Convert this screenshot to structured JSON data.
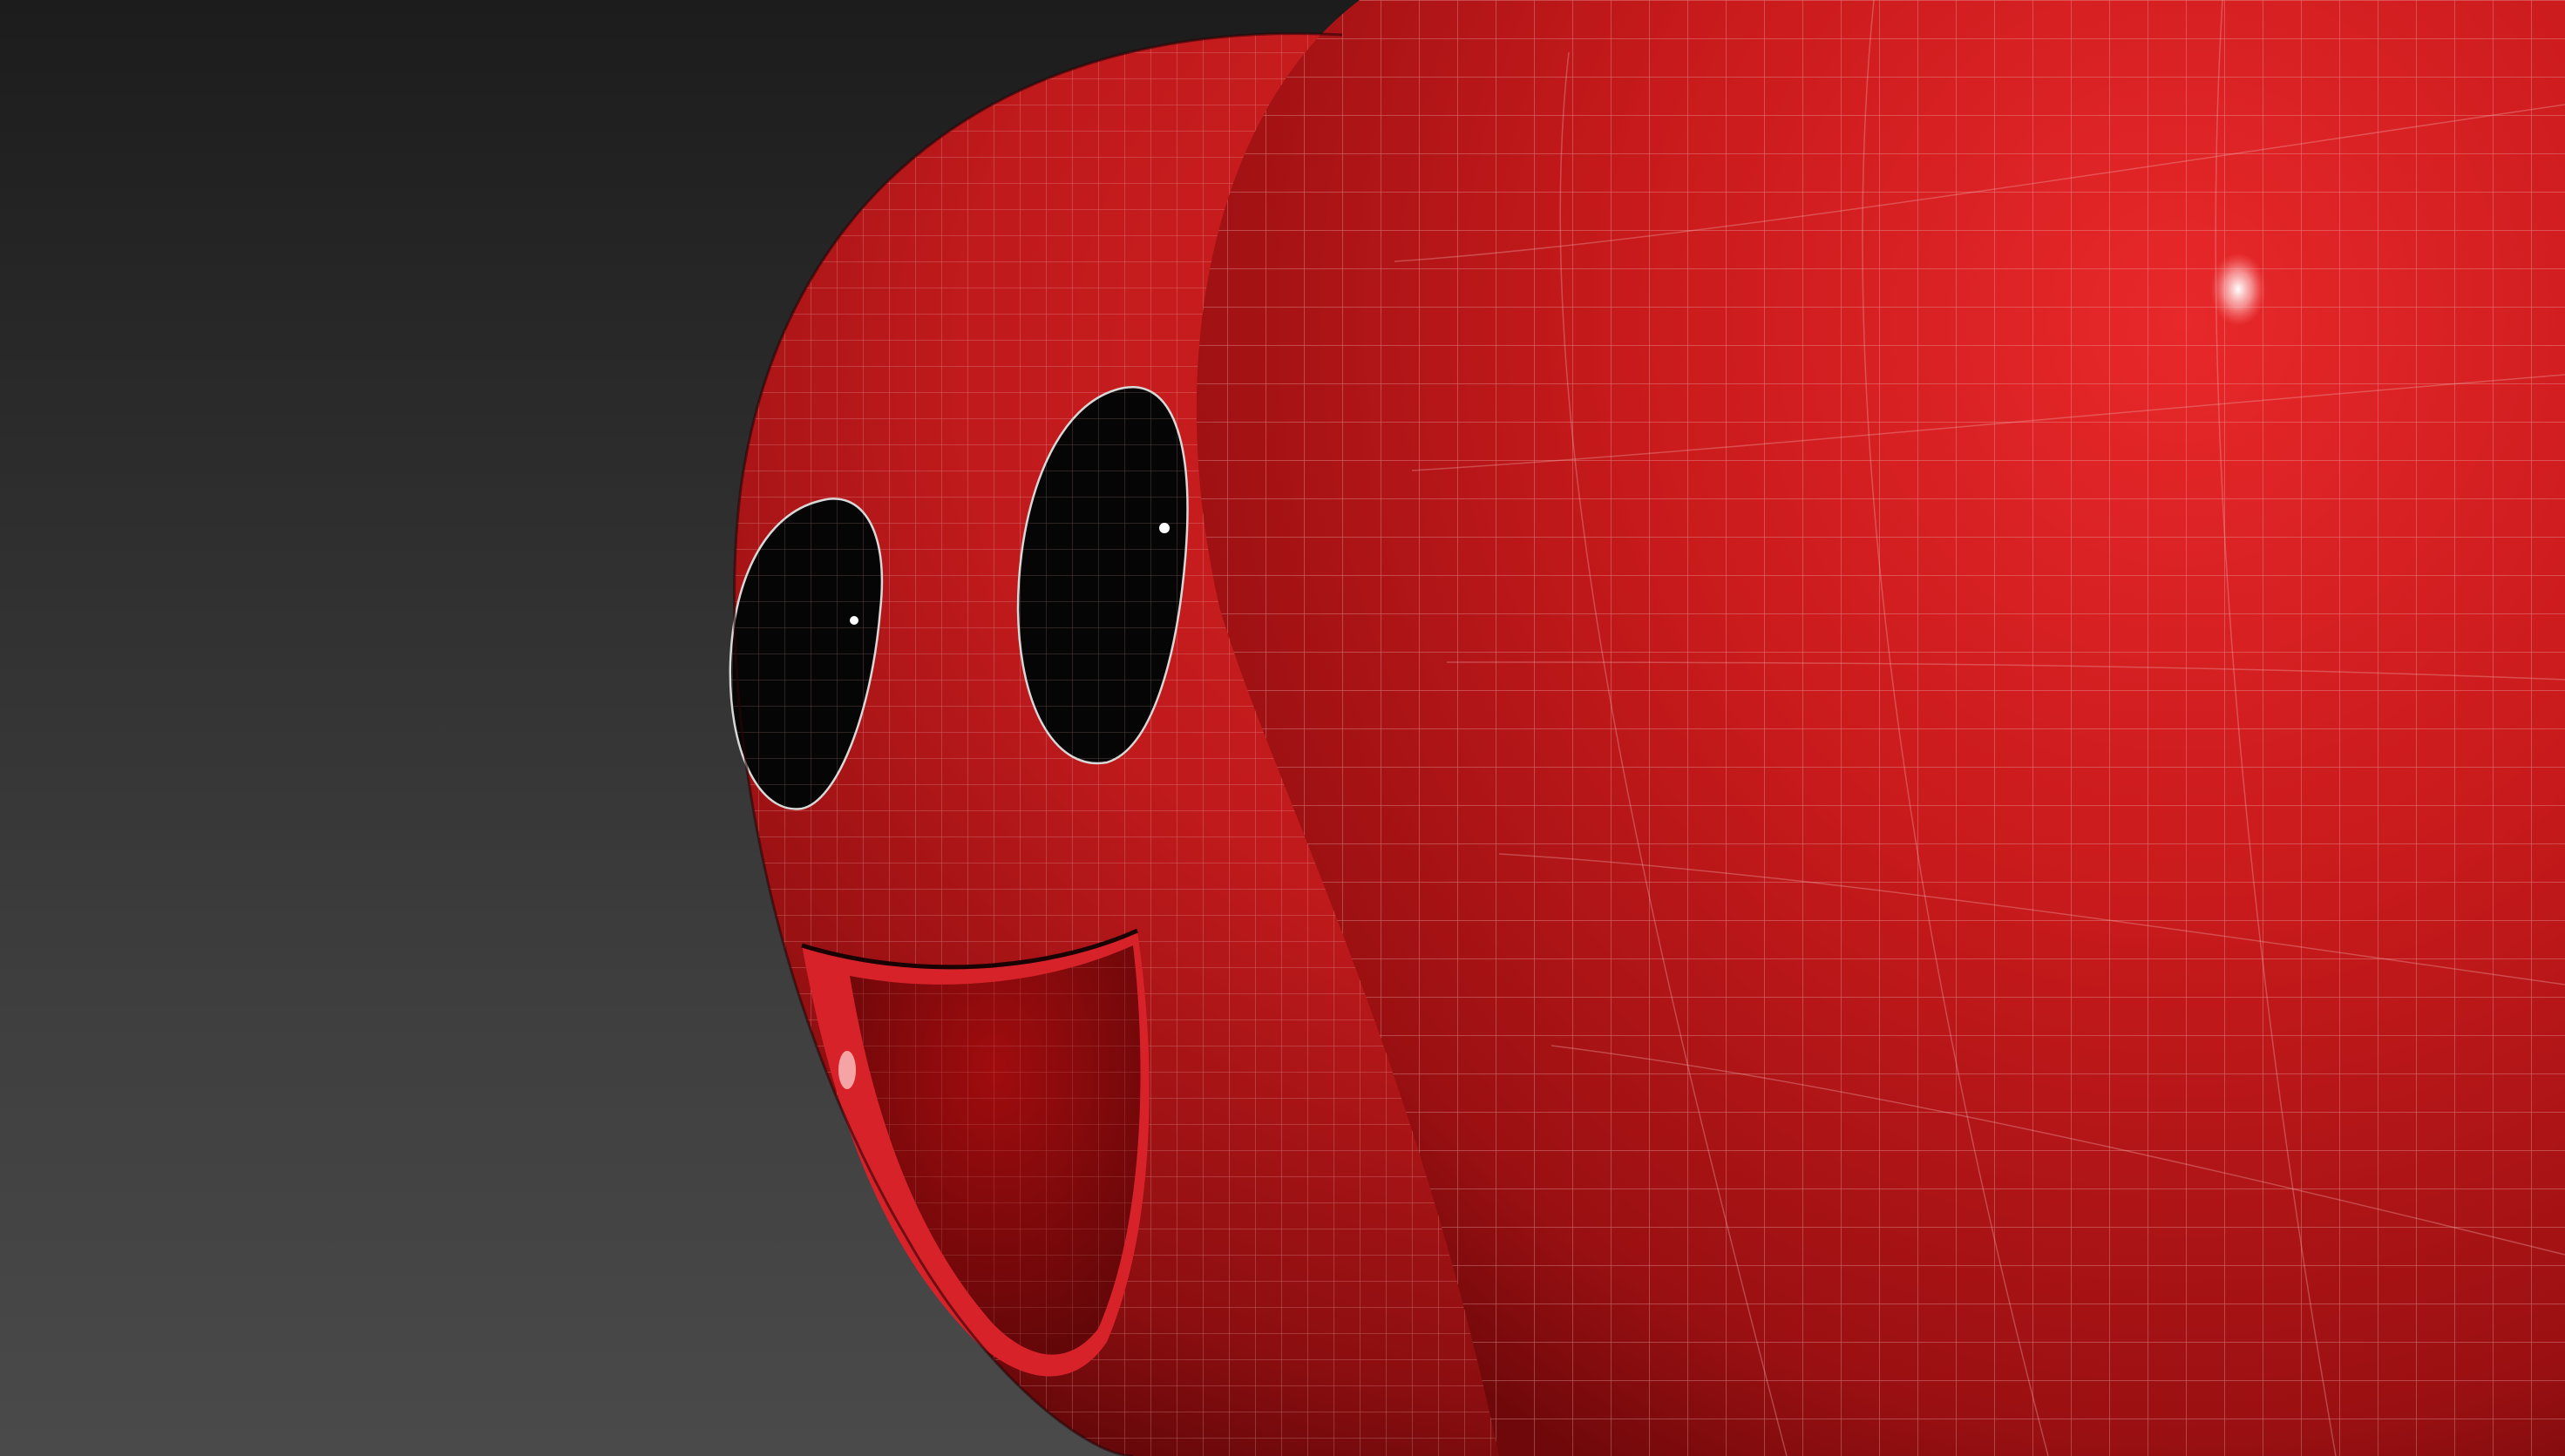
{
  "viewport": {
    "background_top": "#1c1c1c",
    "background_bottom": "#4a4a4a"
  },
  "model": {
    "material_color": "#c81a1c",
    "material_highlight": "#e8282a",
    "material_shadow": "#7a0a0c",
    "wireframe_color": "#e8a0a0",
    "eye_color": "#050505",
    "mouth_inner_color": "#8c0a0c",
    "specular_color": "#ffffff",
    "parts": [
      "head-sphere",
      "body-sphere",
      "left-eye",
      "right-eye",
      "mouth"
    ]
  }
}
